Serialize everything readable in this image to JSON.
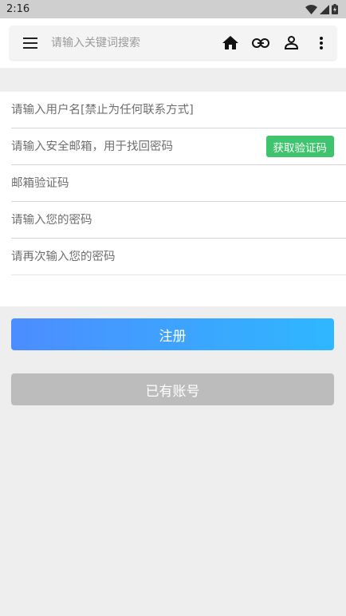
{
  "status_bar": {
    "time": "2:16"
  },
  "search": {
    "placeholder": "请输入关键词搜索"
  },
  "toolbar": {
    "icons": [
      "menu-icon",
      "home-icon",
      "link-icon",
      "person-icon",
      "more-vert-icon"
    ]
  },
  "form": {
    "username_placeholder": "请输入用户名[禁止为任何联系方式]",
    "email_placeholder": "请输入安全邮箱，用于找回密码",
    "get_code_label": "获取验证码",
    "code_placeholder": "邮箱验证码",
    "password_placeholder": "请输入您的密码",
    "confirm_password_placeholder": "请再次输入您的密码"
  },
  "actions": {
    "register_label": "注册",
    "have_account_label": "已有账号"
  },
  "colors": {
    "accent_start": "#4c8dff",
    "accent_end": "#2fb7ff",
    "code_button": "#3ec46d",
    "secondary_button": "#bcbcbc"
  }
}
